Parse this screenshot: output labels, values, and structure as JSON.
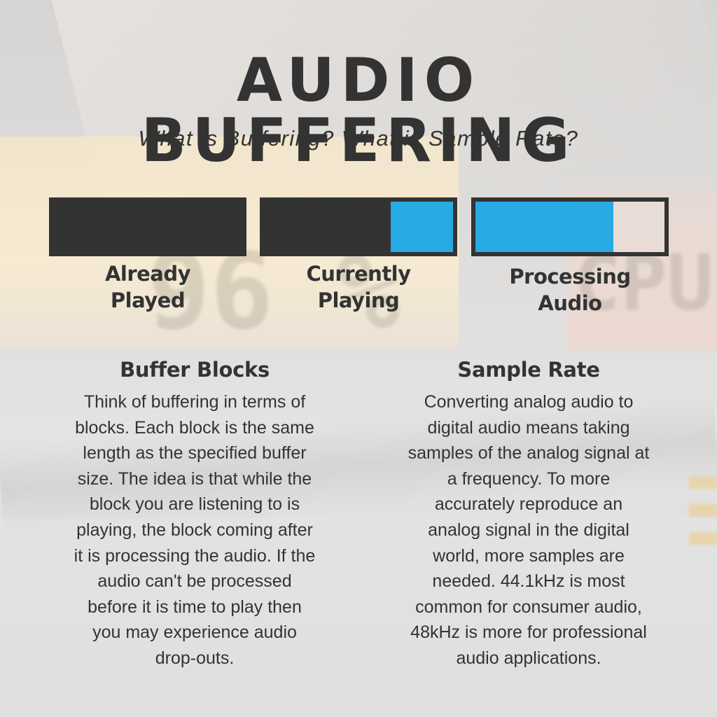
{
  "header": {
    "title": "AUDIO BUFFERING",
    "subtitle": "What is Buffering? What is Sample Rate?"
  },
  "colors": {
    "dark": "#333333",
    "accent_blue": "#27a9e1",
    "text": "#333333"
  },
  "buffer_diagram": {
    "blocks": [
      {
        "label_lines": [
          "Already",
          "Played"
        ],
        "played_fraction": 1.0,
        "processed_fraction": 0.0
      },
      {
        "label_lines": [
          "Currently",
          "Playing"
        ],
        "played_fraction": 0.67,
        "processed_fraction": 0.33
      },
      {
        "label_lines": [
          "Processing",
          "Audio"
        ],
        "played_fraction": 0.0,
        "processed_fraction": 0.73
      }
    ]
  },
  "sections": [
    {
      "heading": "Buffer Blocks",
      "lines": [
        "Think of buffering in terms of",
        "blocks. Each block is the same",
        "length as the specified buffer",
        "size. The idea is that while the",
        "block you are listening to is",
        "playing, the block coming after",
        "it is processing the audio. If the",
        "audio can't be processed",
        "before it is time to play then",
        "you may experience audio",
        "drop-outs."
      ]
    },
    {
      "heading": "Sample Rate",
      "lines": [
        "Converting analog audio to",
        "digital audio means taking",
        "samples of the analog signal at",
        "a frequency. To more",
        "accurately reproduce an",
        "analog signal in the digital",
        "world, more samples are",
        "needed. 44.1kHz is most",
        "common for consumer audio,",
        "48kHz is more for professional",
        "audio applications."
      ]
    }
  ]
}
